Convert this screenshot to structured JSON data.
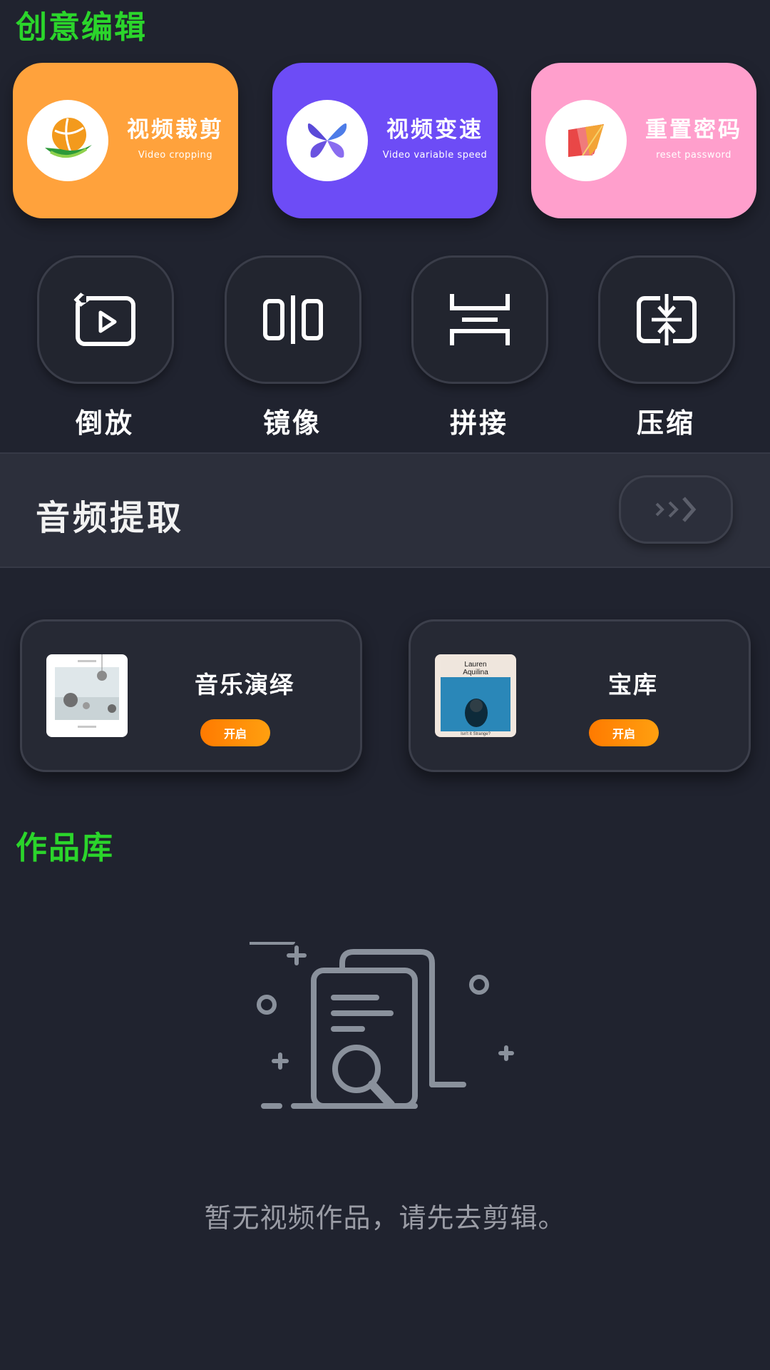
{
  "sections": {
    "creative_title": "创意编辑",
    "works_title": "作品库"
  },
  "feature_cards": [
    {
      "title": "视频裁剪",
      "subtitle": "Video cropping",
      "color": "#ffa23c",
      "icon": "orange-ball-icon"
    },
    {
      "title": "视频变速",
      "subtitle": "Video variable speed",
      "color": "#6d4cf6",
      "icon": "butterfly-flower-icon"
    },
    {
      "title": "重置密码",
      "subtitle": "reset password",
      "color": "#ff9fcc",
      "icon": "colorful-flag-icon"
    }
  ],
  "tools": [
    {
      "label": "倒放",
      "icon": "reverse-play-icon"
    },
    {
      "label": "镜像",
      "icon": "mirror-icon"
    },
    {
      "label": "拼接",
      "icon": "splice-icon"
    },
    {
      "label": "压缩",
      "icon": "compress-icon"
    }
  ],
  "audio_extract": {
    "title": "音频提取",
    "icon": "chevrons-right-icon"
  },
  "music_cards": [
    {
      "title": "音乐演绎",
      "button": "开启",
      "cover": "album-cover-art"
    },
    {
      "title": "宝库",
      "button": "开启",
      "cover": "album-cover-lauren-aquilina",
      "cover_title": "Lauren\nAquilina",
      "cover_caption": "Isn't It Strange?"
    }
  ],
  "empty_state": {
    "text": "暂无视频作品，请先去剪辑。",
    "icon": "empty-document-search-icon"
  },
  "colors": {
    "background": "#20232f",
    "section_title": "#2bd52b",
    "open_button": "#ff8a00"
  }
}
